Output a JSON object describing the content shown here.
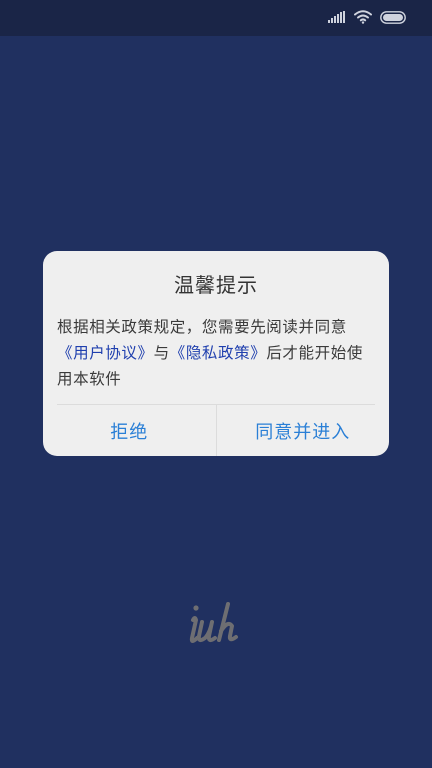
{
  "status_bar": {
    "icons": [
      "signal-icon",
      "wifi-icon",
      "battery-icon"
    ]
  },
  "dialog": {
    "title": "温馨提示",
    "body_prefix": "根据相关政策规定，您需要先阅读并同意",
    "user_agreement_link": "《用户协议》",
    "conjunction": "与",
    "privacy_policy_link": "《隐私政策》",
    "body_suffix": "后才能开始使用本软件",
    "reject_label": "拒绝",
    "accept_label": "同意并进入"
  },
  "logo": {
    "text": "iuh"
  },
  "colors": {
    "background": "#203060",
    "status_bar": "#1a2547",
    "dialog_bg": "#efefef",
    "link": "#1f3fae",
    "button_text": "#2a7fd6"
  }
}
